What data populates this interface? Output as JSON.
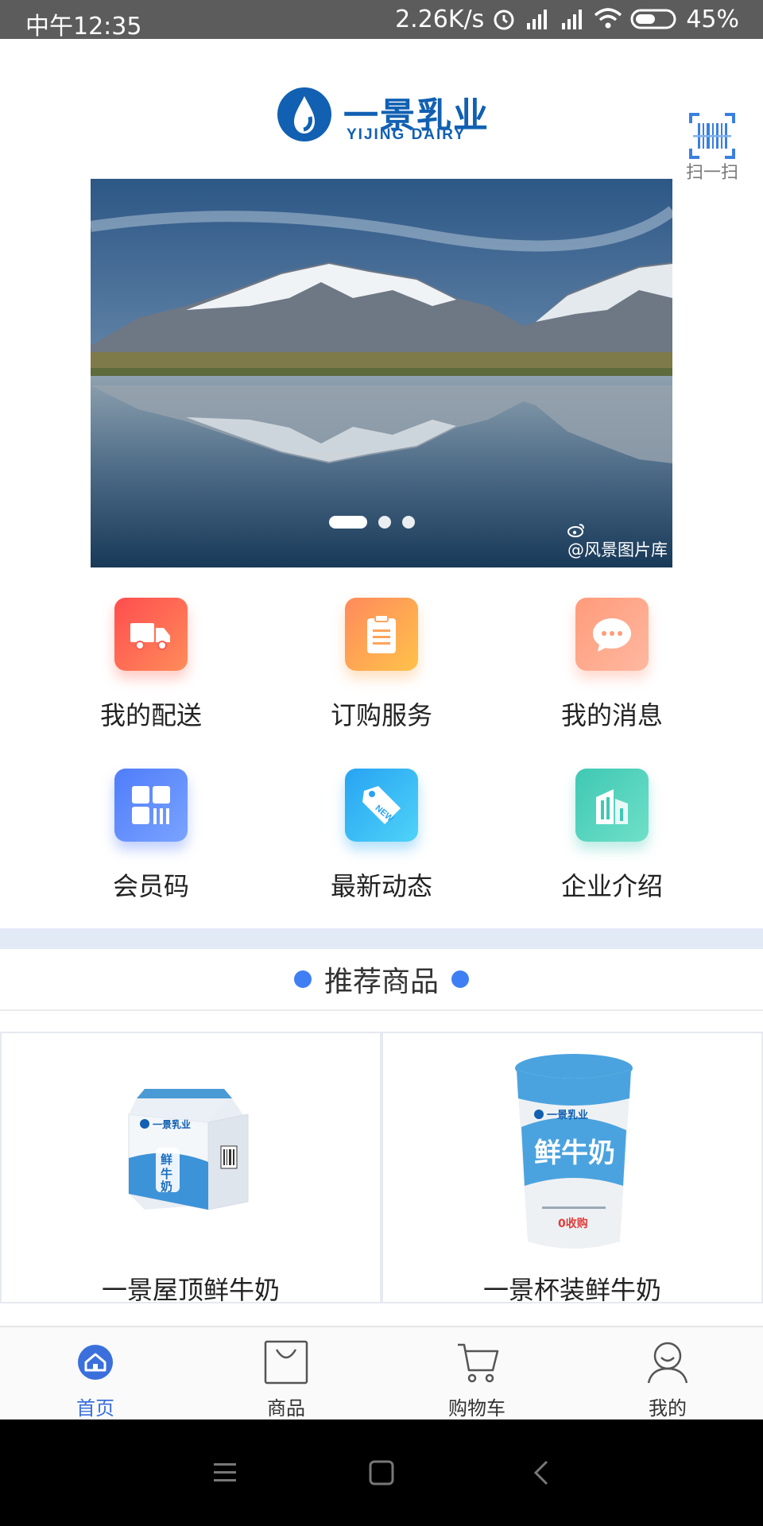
{
  "status_bar": {
    "time": "中午12:35",
    "network_speed": "2.26K/s",
    "battery": "45%"
  },
  "header": {
    "logo_cn": "一景乳业",
    "logo_en": "YIJING DAIRY",
    "scan_label": "扫一扫",
    "scan_icon": "barcode-scan-icon"
  },
  "banner": {
    "watermark": "@风景图片库",
    "slide_count": 3,
    "active_slide": 1
  },
  "quick_menu": [
    {
      "label": "我的配送",
      "icon": "delivery-truck-icon",
      "color_from": "#ff4d4f",
      "color_to": "#ff8c5a"
    },
    {
      "label": "订购服务",
      "icon": "clipboard-icon",
      "color_from": "#ff8a5c",
      "color_to": "#ffc24a"
    },
    {
      "label": "我的消息",
      "icon": "chat-bubble-icon",
      "color_from": "#ff9b7a",
      "color_to": "#ffb8a0"
    },
    {
      "label": "会员码",
      "icon": "member-code-icon",
      "color_from": "#4f7dfa",
      "color_to": "#7aa3ff"
    },
    {
      "label": "最新动态",
      "icon": "new-tag-icon",
      "color_from": "#27a3f2",
      "color_to": "#4fd3f8"
    },
    {
      "label": "企业介绍",
      "icon": "building-icon",
      "color_from": "#3fc8b4",
      "color_to": "#6fe0c8"
    }
  ],
  "recommend": {
    "title": "推荐商品",
    "products": [
      {
        "name": "一景屋顶鲜牛奶",
        "image": "milk-carton-image"
      },
      {
        "name": "一景杯装鲜牛奶",
        "image": "milk-cup-image"
      }
    ]
  },
  "tabbar": [
    {
      "label": "首页",
      "icon": "home-icon",
      "active": true
    },
    {
      "label": "商品",
      "icon": "shopping-bag-icon",
      "active": false
    },
    {
      "label": "购物车",
      "icon": "cart-icon",
      "active": false
    },
    {
      "label": "我的",
      "icon": "user-icon",
      "active": false
    }
  ],
  "colors": {
    "brand": "#1160b2",
    "accent": "#3f7ff3",
    "separator": "#e2eaf6"
  }
}
